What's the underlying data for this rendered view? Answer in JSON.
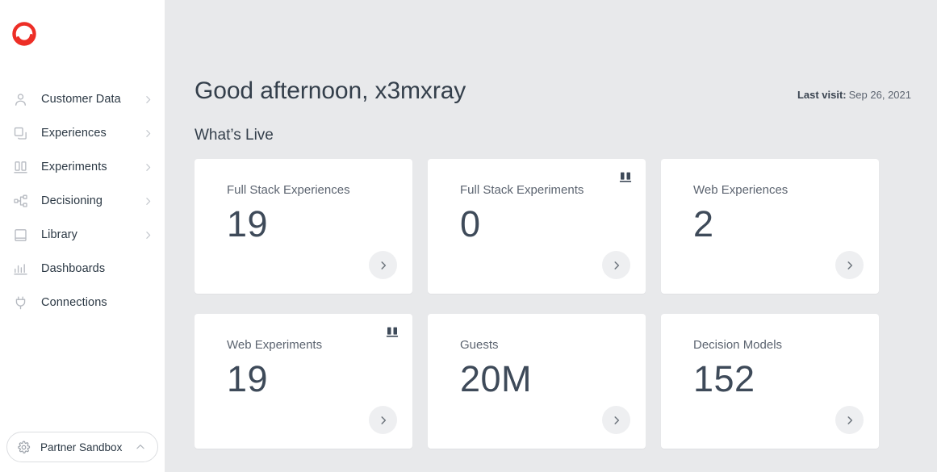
{
  "brand": {
    "logo_icon": "optimizely-logo-icon",
    "logo_color": "#ed2e26"
  },
  "sidebar": {
    "items": [
      {
        "label": "Customer Data",
        "icon": "person-icon",
        "has_chevron": true
      },
      {
        "label": "Experiences",
        "icon": "layers-icon",
        "has_chevron": true
      },
      {
        "label": "Experiments",
        "icon": "beakers-icon",
        "has_chevron": true
      },
      {
        "label": "Decisioning",
        "icon": "node-tree-icon",
        "has_chevron": true
      },
      {
        "label": "Library",
        "icon": "book-icon",
        "has_chevron": true
      },
      {
        "label": "Dashboards",
        "icon": "bar-chart-icon",
        "has_chevron": false
      },
      {
        "label": "Connections",
        "icon": "plug-icon",
        "has_chevron": false
      }
    ],
    "org_switcher": {
      "label": "Partner Sandbox",
      "icon": "gear-icon",
      "chevron": "chevron-up-icon"
    }
  },
  "header": {
    "greeting": "Good afternoon, x3mxray",
    "last_visit_label": "Last visit:",
    "last_visit_value": "Sep 26, 2021"
  },
  "main": {
    "section_title": "What’s Live",
    "cards": [
      {
        "label": "Full Stack Experiences",
        "value": "19",
        "badge": null,
        "go_icon": "chevron-right-icon"
      },
      {
        "label": "Full Stack Experiments",
        "value": "0",
        "badge": "beakers-icon",
        "go_icon": "chevron-right-icon"
      },
      {
        "label": "Web Experiences",
        "value": "2",
        "badge": null,
        "go_icon": "chevron-right-icon"
      },
      {
        "label": "Web Experiments",
        "value": "19",
        "badge": "beakers-icon",
        "go_icon": "chevron-right-icon"
      },
      {
        "label": "Guests",
        "value": "20M",
        "badge": null,
        "go_icon": "chevron-right-icon"
      },
      {
        "label": "Decision Models",
        "value": "152",
        "badge": null,
        "go_icon": "chevron-right-icon"
      }
    ]
  },
  "colors": {
    "page_background": "#e8e9eb",
    "card_background": "#ffffff",
    "text_dark": "#343f4b",
    "text_muted": "#5c6470",
    "value_color": "#3e4a59",
    "icon_muted": "#b6bac1"
  }
}
